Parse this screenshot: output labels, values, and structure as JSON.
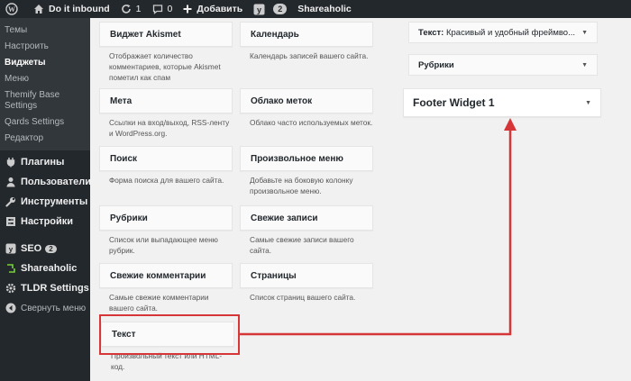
{
  "adminbar": {
    "site_name": "Do it inbound",
    "updates_count": "1",
    "comments_count": "0",
    "add_new_label": "Добавить",
    "yoast_count": "2",
    "shareaholic_label": "Shareaholic"
  },
  "sidebar": {
    "submenu": [
      "Темы",
      "Настроить",
      "Виджеты",
      "Меню",
      "Themify Base Settings",
      "Qards Settings",
      "Редактор"
    ],
    "current_submenu": "Виджеты",
    "menu": [
      {
        "label": "Плагины",
        "icon": "plugin-icon"
      },
      {
        "label": "Пользователи",
        "icon": "users-icon"
      },
      {
        "label": "Инструменты",
        "icon": "tools-icon"
      },
      {
        "label": "Настройки",
        "icon": "settings-icon"
      },
      {
        "label": "SEO",
        "icon": "seo-icon",
        "badge": "2"
      },
      {
        "label": "Shareaholic",
        "icon": "shareaholic-icon"
      },
      {
        "label": "TLDR Settings",
        "icon": "tldr-icon"
      }
    ],
    "collapse_label": "Свернуть меню"
  },
  "widgets": [
    {
      "title": "Виджет Akismet",
      "desc": "Отображает количество комментариев, которые Akismet пометил как спам"
    },
    {
      "title": "Календарь",
      "desc": "Календарь записей вашего сайта."
    },
    {
      "title": "Мета",
      "desc": "Ссылки на вход/выход, RSS-ленту и WordPress.org."
    },
    {
      "title": "Облако меток",
      "desc": "Облако часто используемых меток."
    },
    {
      "title": "Поиск",
      "desc": "Форма поиска для вашего сайта."
    },
    {
      "title": "Произвольное меню",
      "desc": "Добавьте на боковую колонку произвольное меню."
    },
    {
      "title": "Рубрики",
      "desc": "Список или выпадающее меню рубрик."
    },
    {
      "title": "Свежие записи",
      "desc": "Самые свежие записи вашего сайта."
    },
    {
      "title": "Свежие комментарии",
      "desc": "Самые свежие комментарии вашего сайта."
    },
    {
      "title": "Страницы",
      "desc": "Список страниц вашего сайта."
    },
    {
      "title": "Текст",
      "desc": "Произвольный текст или HTML-код."
    }
  ],
  "widget_area": {
    "text_widget_title": "Текст:",
    "text_widget_subtitle": "Красивый и удобный фреймво...",
    "rubrics_widget_title": "Рубрики",
    "footer_title": "Footer Widget 1"
  },
  "colors": {
    "admin_dark": "#23282d",
    "highlight_red": "#d63638"
  }
}
